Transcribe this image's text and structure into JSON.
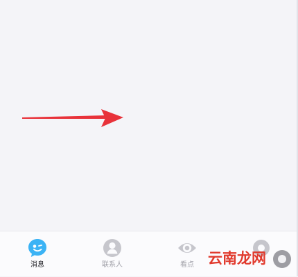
{
  "tabbar": {
    "items": [
      {
        "label": "消息",
        "icon": "chat-bubble-icon",
        "active": true
      },
      {
        "label": "联系人",
        "icon": "contact-person-icon",
        "active": false
      },
      {
        "label": "看点",
        "icon": "eye-icon",
        "active": false
      },
      {
        "label": "",
        "icon": "dynamic-icon",
        "active": false
      }
    ]
  },
  "watermark": {
    "text": "云南龙网"
  },
  "colors": {
    "accent": "#3bb3f5",
    "inactive_icon": "#c6c6cc",
    "annotation_arrow": "#e8323a",
    "watermark": "#e13a2d"
  }
}
